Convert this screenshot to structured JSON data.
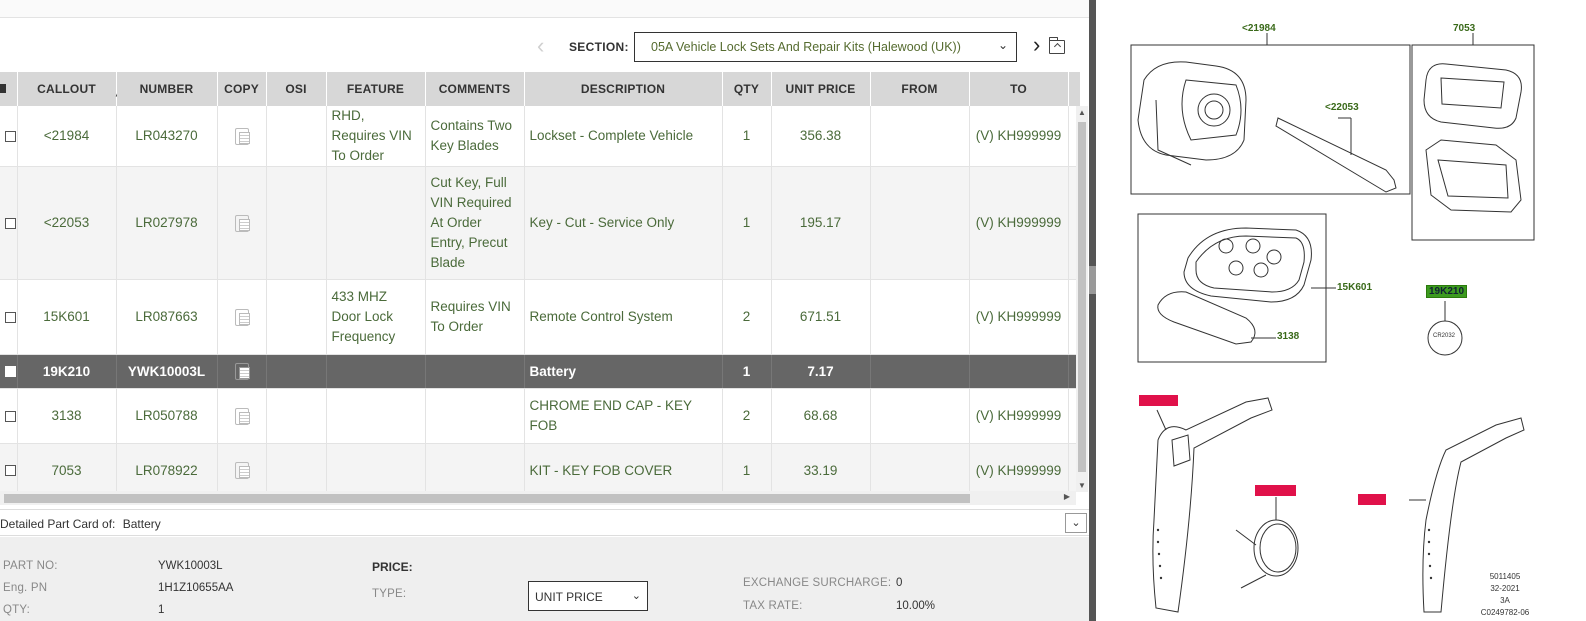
{
  "section": {
    "label": "SECTION:",
    "selected": "05A Vehicle Lock Sets And Repair Kits (Halewood (UK))"
  },
  "table": {
    "columns": [
      "CALLOUT",
      "NUMBER",
      "COPY",
      "OSI",
      "FEATURE",
      "COMMENTS",
      "DESCRIPTION",
      "QTY",
      "UNIT PRICE",
      "FROM",
      "TO"
    ],
    "sort_column": "CALLOUT",
    "rows": [
      {
        "callout": "<21984",
        "number": "LR043270",
        "osi": "",
        "feature": "RHD, Requires VIN To Order",
        "comments": "Contains Two Key Blades",
        "description": "Lockset - Complete Vehicle",
        "qty": "1",
        "unit_price": "356.38",
        "from": "",
        "to": "(V) KH999999"
      },
      {
        "callout": "<22053",
        "number": "LR027978",
        "osi": "",
        "feature": "",
        "comments": "Cut Key, Full VIN Required At Order Entry, Precut Blade",
        "description": "Key - Cut - Service Only",
        "qty": "1",
        "unit_price": "195.17",
        "from": "",
        "to": "(V) KH999999"
      },
      {
        "callout": "15K601",
        "number": "LR087663",
        "osi": "",
        "feature": "433 MHZ Door Lock Frequency",
        "comments": "Requires VIN To Order",
        "description": "Remote Control System",
        "qty": "2",
        "unit_price": "671.51",
        "from": "",
        "to": "(V) KH999999"
      },
      {
        "callout": "19K210",
        "number": "YWK10003L",
        "osi": "",
        "feature": "",
        "comments": "",
        "description": "Battery",
        "qty": "1",
        "unit_price": "7.17",
        "from": "",
        "to": "",
        "selected": true
      },
      {
        "callout": "3138",
        "number": "LR050788",
        "osi": "",
        "feature": "",
        "comments": "",
        "description": "CHROME END CAP - KEY FOB",
        "qty": "2",
        "unit_price": "68.68",
        "from": "",
        "to": "(V) KH999999"
      },
      {
        "callout": "7053",
        "number": "LR078922",
        "osi": "",
        "feature": "",
        "comments": "",
        "description": "KIT - KEY FOB COVER",
        "qty": "1",
        "unit_price": "33.19",
        "from": "",
        "to": "(V) KH999999"
      }
    ]
  },
  "part_card": {
    "title_prefix": "Detailed Part Card of:",
    "title_value": "Battery",
    "part_no_label": "PART NO:",
    "part_no": "YWK10003L",
    "eng_pn_label": "Eng. PN",
    "eng_pn": "1H1Z10655AA",
    "qty_label": "QTY:",
    "qty": "1",
    "price_label": "PRICE:",
    "type_label": "TYPE:",
    "type_value": "UNIT PRICE",
    "exchange_label": "EXCHANGE SURCHARGE:",
    "exchange_value": "0",
    "tax_label": "TAX RATE:",
    "tax_value": "10.00%"
  },
  "illustration": {
    "callouts": [
      "<21984",
      "7053",
      "<22053",
      "15K601",
      "3138",
      "19K210"
    ],
    "highlighted_callout": "19K210",
    "battery_text": "CR2032",
    "footer": [
      "5011405",
      "32-2021",
      "3A",
      "C0249782-06"
    ]
  },
  "colors": {
    "accent_green": "#4a6a3a",
    "selected_row": "#666666",
    "highlight_green": "#3c9a1f",
    "highlight_red": "#e0114a"
  }
}
